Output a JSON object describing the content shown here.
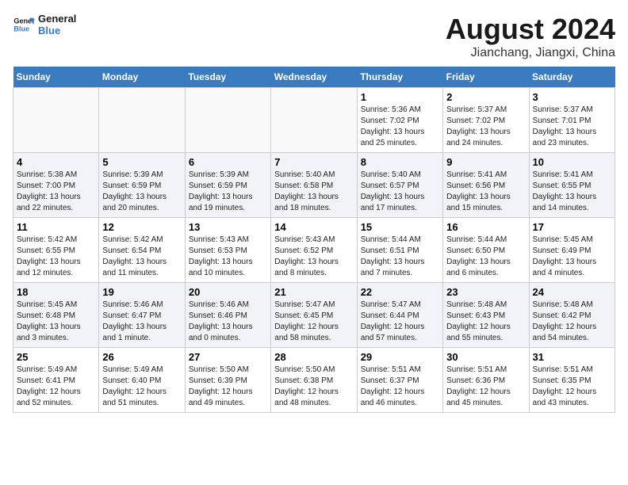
{
  "logo": {
    "line1": "General",
    "line2": "Blue"
  },
  "title": "August 2024",
  "subtitle": "Jianchang, Jiangxi, China",
  "weekdays": [
    "Sunday",
    "Monday",
    "Tuesday",
    "Wednesday",
    "Thursday",
    "Friday",
    "Saturday"
  ],
  "weeks": [
    [
      {
        "day": "",
        "info": ""
      },
      {
        "day": "",
        "info": ""
      },
      {
        "day": "",
        "info": ""
      },
      {
        "day": "",
        "info": ""
      },
      {
        "day": "1",
        "info": "Sunrise: 5:36 AM\nSunset: 7:02 PM\nDaylight: 13 hours and 25 minutes."
      },
      {
        "day": "2",
        "info": "Sunrise: 5:37 AM\nSunset: 7:02 PM\nDaylight: 13 hours and 24 minutes."
      },
      {
        "day": "3",
        "info": "Sunrise: 5:37 AM\nSunset: 7:01 PM\nDaylight: 13 hours and 23 minutes."
      }
    ],
    [
      {
        "day": "4",
        "info": "Sunrise: 5:38 AM\nSunset: 7:00 PM\nDaylight: 13 hours and 22 minutes."
      },
      {
        "day": "5",
        "info": "Sunrise: 5:39 AM\nSunset: 6:59 PM\nDaylight: 13 hours and 20 minutes."
      },
      {
        "day": "6",
        "info": "Sunrise: 5:39 AM\nSunset: 6:59 PM\nDaylight: 13 hours and 19 minutes."
      },
      {
        "day": "7",
        "info": "Sunrise: 5:40 AM\nSunset: 6:58 PM\nDaylight: 13 hours and 18 minutes."
      },
      {
        "day": "8",
        "info": "Sunrise: 5:40 AM\nSunset: 6:57 PM\nDaylight: 13 hours and 17 minutes."
      },
      {
        "day": "9",
        "info": "Sunrise: 5:41 AM\nSunset: 6:56 PM\nDaylight: 13 hours and 15 minutes."
      },
      {
        "day": "10",
        "info": "Sunrise: 5:41 AM\nSunset: 6:55 PM\nDaylight: 13 hours and 14 minutes."
      }
    ],
    [
      {
        "day": "11",
        "info": "Sunrise: 5:42 AM\nSunset: 6:55 PM\nDaylight: 13 hours and 12 minutes."
      },
      {
        "day": "12",
        "info": "Sunrise: 5:42 AM\nSunset: 6:54 PM\nDaylight: 13 hours and 11 minutes."
      },
      {
        "day": "13",
        "info": "Sunrise: 5:43 AM\nSunset: 6:53 PM\nDaylight: 13 hours and 10 minutes."
      },
      {
        "day": "14",
        "info": "Sunrise: 5:43 AM\nSunset: 6:52 PM\nDaylight: 13 hours and 8 minutes."
      },
      {
        "day": "15",
        "info": "Sunrise: 5:44 AM\nSunset: 6:51 PM\nDaylight: 13 hours and 7 minutes."
      },
      {
        "day": "16",
        "info": "Sunrise: 5:44 AM\nSunset: 6:50 PM\nDaylight: 13 hours and 6 minutes."
      },
      {
        "day": "17",
        "info": "Sunrise: 5:45 AM\nSunset: 6:49 PM\nDaylight: 13 hours and 4 minutes."
      }
    ],
    [
      {
        "day": "18",
        "info": "Sunrise: 5:45 AM\nSunset: 6:48 PM\nDaylight: 13 hours and 3 minutes."
      },
      {
        "day": "19",
        "info": "Sunrise: 5:46 AM\nSunset: 6:47 PM\nDaylight: 13 hours and 1 minute."
      },
      {
        "day": "20",
        "info": "Sunrise: 5:46 AM\nSunset: 6:46 PM\nDaylight: 13 hours and 0 minutes."
      },
      {
        "day": "21",
        "info": "Sunrise: 5:47 AM\nSunset: 6:45 PM\nDaylight: 12 hours and 58 minutes."
      },
      {
        "day": "22",
        "info": "Sunrise: 5:47 AM\nSunset: 6:44 PM\nDaylight: 12 hours and 57 minutes."
      },
      {
        "day": "23",
        "info": "Sunrise: 5:48 AM\nSunset: 6:43 PM\nDaylight: 12 hours and 55 minutes."
      },
      {
        "day": "24",
        "info": "Sunrise: 5:48 AM\nSunset: 6:42 PM\nDaylight: 12 hours and 54 minutes."
      }
    ],
    [
      {
        "day": "25",
        "info": "Sunrise: 5:49 AM\nSunset: 6:41 PM\nDaylight: 12 hours and 52 minutes."
      },
      {
        "day": "26",
        "info": "Sunrise: 5:49 AM\nSunset: 6:40 PM\nDaylight: 12 hours and 51 minutes."
      },
      {
        "day": "27",
        "info": "Sunrise: 5:50 AM\nSunset: 6:39 PM\nDaylight: 12 hours and 49 minutes."
      },
      {
        "day": "28",
        "info": "Sunrise: 5:50 AM\nSunset: 6:38 PM\nDaylight: 12 hours and 48 minutes."
      },
      {
        "day": "29",
        "info": "Sunrise: 5:51 AM\nSunset: 6:37 PM\nDaylight: 12 hours and 46 minutes."
      },
      {
        "day": "30",
        "info": "Sunrise: 5:51 AM\nSunset: 6:36 PM\nDaylight: 12 hours and 45 minutes."
      },
      {
        "day": "31",
        "info": "Sunrise: 5:51 AM\nSunset: 6:35 PM\nDaylight: 12 hours and 43 minutes."
      }
    ]
  ]
}
